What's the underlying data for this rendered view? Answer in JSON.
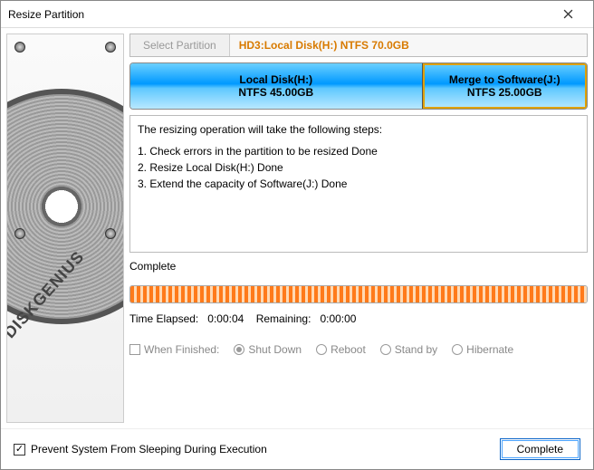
{
  "window": {
    "title": "Resize Partition"
  },
  "sidebar": {
    "brand": "DISKGENIUS"
  },
  "tabrow": {
    "button_label": "Select Partition",
    "disk_label": "HD3:Local Disk(H:) NTFS 70.0GB"
  },
  "partitions": [
    {
      "line1": "Local Disk(H:)",
      "line2": "NTFS 45.00GB",
      "width_pct": 64,
      "selected": false
    },
    {
      "line1": "Merge to Software(J:)",
      "line2": "NTFS 25.00GB",
      "width_pct": 36,
      "selected": true
    }
  ],
  "steps": {
    "intro": "The resizing operation will take the following steps:",
    "items": [
      "1. Check errors in the partition to be resized    Done",
      "2. Resize Local Disk(H:)    Done",
      "3. Extend the capacity of Software(J:)    Done"
    ]
  },
  "status": {
    "label": "Complete",
    "progress_pct": 100,
    "time_elapsed_label": "Time Elapsed:",
    "time_elapsed_value": "0:00:04",
    "remaining_label": "Remaining:",
    "remaining_value": "0:00:00"
  },
  "finish": {
    "when_label": "When Finished:",
    "options": {
      "shutdown": "Shut Down",
      "reboot": "Reboot",
      "standby": "Stand by",
      "hibernate": "Hibernate"
    },
    "selected": "shutdown",
    "enabled": false
  },
  "footer": {
    "prevent_sleep_label": "Prevent System From Sleeping During Execution",
    "prevent_sleep_checked": true,
    "complete_button": "Complete"
  }
}
